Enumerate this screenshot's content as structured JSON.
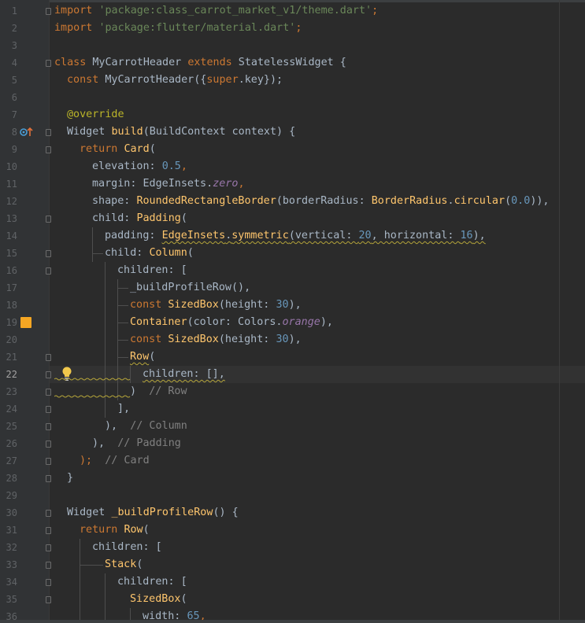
{
  "editor": {
    "current_line": 22,
    "line_numbers": [
      "1",
      "2",
      "3",
      "4",
      "5",
      "6",
      "7",
      "8",
      "9",
      "10",
      "11",
      "12",
      "13",
      "14",
      "15",
      "16",
      "17",
      "18",
      "19",
      "20",
      "21",
      "22",
      "23",
      "24",
      "25",
      "26",
      "27",
      "28",
      "29",
      "30",
      "31",
      "32",
      "33",
      "34",
      "35",
      "36"
    ],
    "swatch_color": "#f5a623",
    "colors": {
      "background": "#2b2b2b",
      "keyword": "#cc7832",
      "string": "#6a8759",
      "number": "#6897bb",
      "function": "#ffc66d",
      "comment": "#808080",
      "annotation": "#bbb529",
      "plain": "#a9b7c6"
    },
    "icons": {
      "override_marker": "override-gutter-icon",
      "color_preview": "color-swatch-icon",
      "intention": "lightbulb-icon"
    }
  },
  "code": {
    "l1": {
      "kw": "import",
      "s": " ",
      "str": "'package:class_carrot_market_v1/theme.dart'",
      "end": ";"
    },
    "l2": {
      "kw": "import",
      "s": " ",
      "str": "'package:flutter/material.dart'",
      "end": ";"
    },
    "l4": {
      "kw1": "class",
      "t1": " MyCarrotHeader ",
      "kw2": "extends",
      "t2": " StatelessWidget {"
    },
    "l5": {
      "kw": "const",
      "t1": " MyCarrotHeader({",
      "kw2": "super",
      "t2": ".key});"
    },
    "l7": {
      "ann": "@override"
    },
    "l8": {
      "t1": "Widget ",
      "fn": "build",
      "t2": "(BuildContext context) {"
    },
    "l9": {
      "kw": "return",
      "s": " ",
      "fn": "Card",
      "t": "("
    },
    "l10": {
      "t": "elevation: ",
      "num": "0.5",
      "end": ","
    },
    "l11": {
      "t": "margin: EdgeInsets.",
      "it": "zero",
      "end": ","
    },
    "l12": {
      "t1": "shape: ",
      "fn1": "RoundedRectangleBorder",
      "t2": "(borderRadius: ",
      "fn2": "BorderRadius",
      "t3": ".",
      "fn3": "circular",
      "t4": "(",
      "num": "0.0",
      "t5": ")),"
    },
    "l13": {
      "t": "child: ",
      "fn": "Padding",
      "end": "("
    },
    "l14": {
      "t1": "padding: ",
      "fn1": "EdgeInsets",
      "t2": ".",
      "fn2": "symmetric",
      "t3": "(vertical: ",
      "num1": "20",
      "t4": ", horizontal: ",
      "num2": "16",
      "t5": "),"
    },
    "l15": {
      "t": "child: ",
      "fn": "Column",
      "end": "("
    },
    "l16": {
      "t": "children: ["
    },
    "l17": {
      "t": "_buildProfileRow(),"
    },
    "l18": {
      "kw": "const",
      "s": " ",
      "fn": "SizedBox",
      "t1": "(height: ",
      "num": "30",
      "t2": "),"
    },
    "l19": {
      "fn": "Container",
      "t1": "(color: Colors.",
      "it": "orange",
      "t2": "),"
    },
    "l20": {
      "kw": "const",
      "s": " ",
      "fn": "SizedBox",
      "t1": "(height: ",
      "num": "30",
      "t2": "),"
    },
    "l21": {
      "fn": "Row",
      "t": "("
    },
    "l22": {
      "t": "children: [],"
    },
    "l23": {
      "t": ")",
      "cm": "// Row"
    },
    "l24": {
      "t": "],"
    },
    "l25": {
      "t": "),",
      "cm": "// Column"
    },
    "l26": {
      "t": "),",
      "cm": "// Padding"
    },
    "l27": {
      "t": ");",
      "cm": "// Card"
    },
    "l28": {
      "t": "}"
    },
    "l30": {
      "t1": "Widget ",
      "fn": "_buildProfileRow",
      "t2": "() {"
    },
    "l31": {
      "kw": "return",
      "s": " ",
      "fn": "Row",
      "t": "("
    },
    "l32": {
      "t": "children: ["
    },
    "l33": {
      "fn": "Stack",
      "t": "("
    },
    "l34": {
      "t": "children: ["
    },
    "l35": {
      "fn": "SizedBox",
      "t": "("
    },
    "l36": {
      "t": "width: ",
      "num": "65",
      "end": ","
    }
  }
}
